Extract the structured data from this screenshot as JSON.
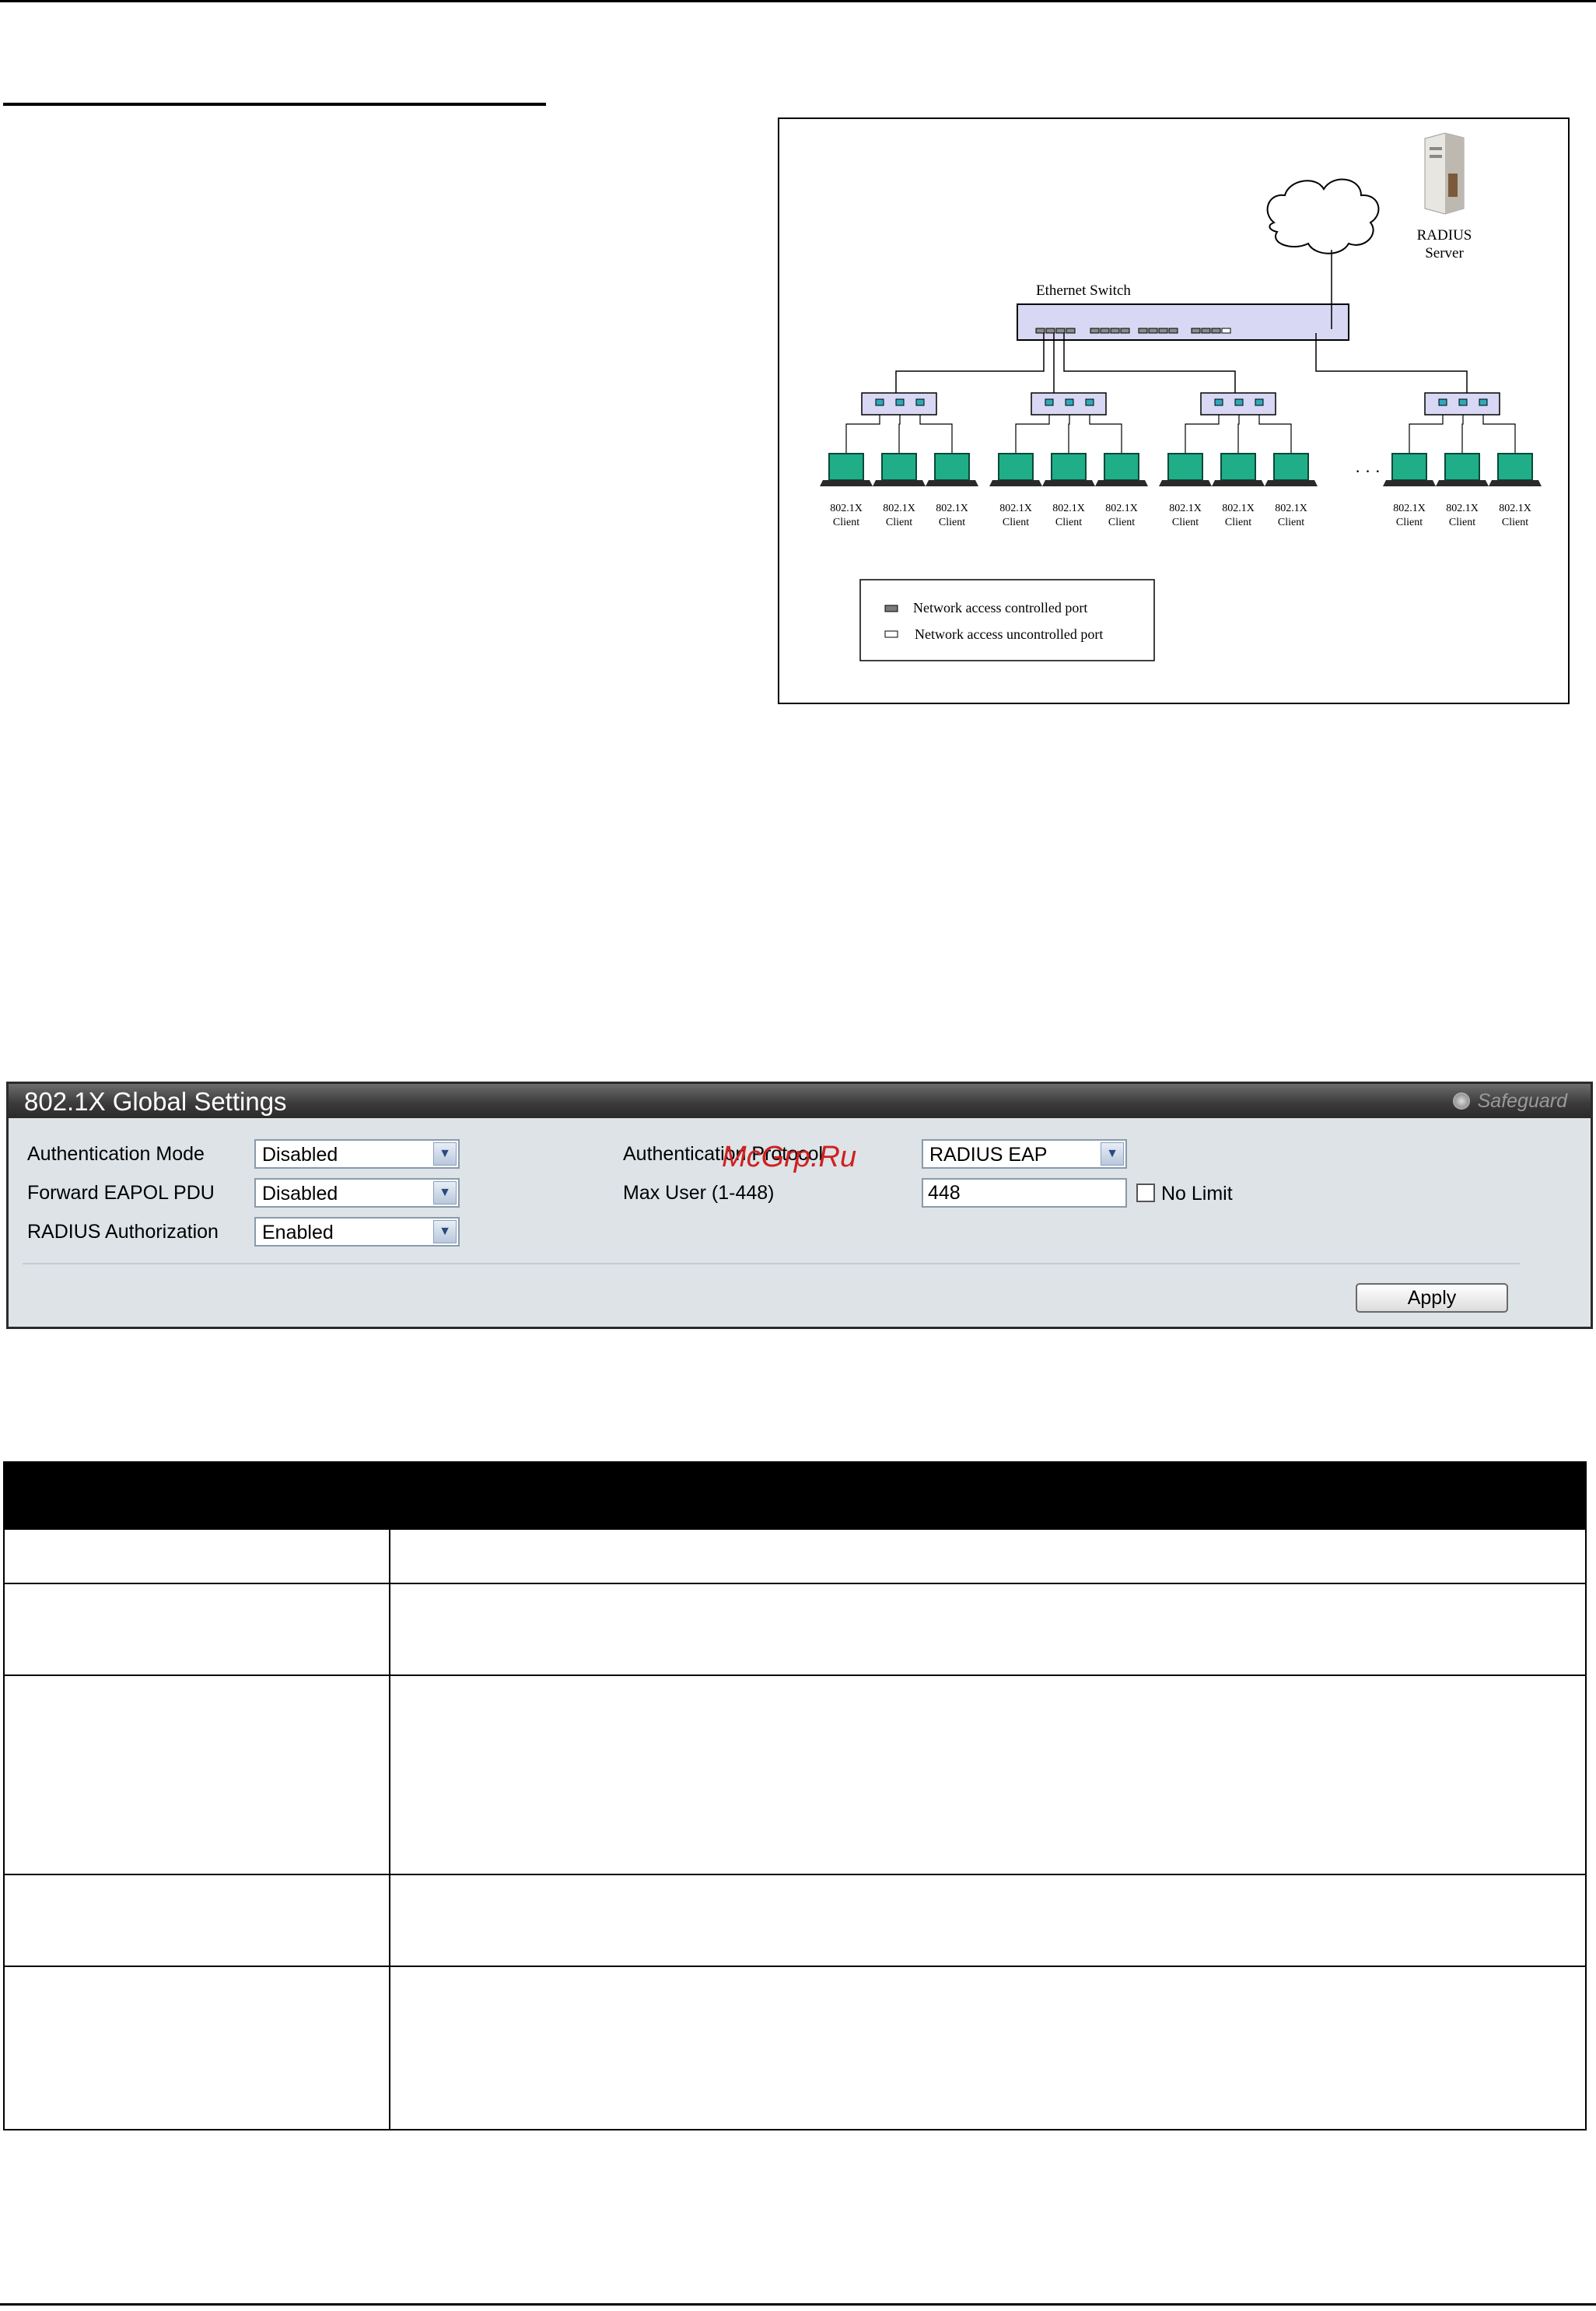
{
  "diagram": {
    "switch_label": "Ethernet Switch",
    "server_label_line1": "RADIUS",
    "server_label_line2": "Server",
    "client_label_line1": "802.1X",
    "client_label_line2": "Client",
    "ellipsis": "· · ·",
    "legend": {
      "controlled": "Network access controlled port",
      "uncontrolled": "Network access uncontrolled port"
    },
    "colors": {
      "switch_fill": "#d8d8f4",
      "client_screen": "#1fae87"
    }
  },
  "panel": {
    "title": "802.1X Global Settings",
    "safeguard_label": "Safeguard",
    "fields": {
      "authentication_mode": {
        "label": "Authentication Mode",
        "value": "Disabled"
      },
      "forward_eapol_pdu": {
        "label": "Forward EAPOL PDU",
        "value": "Disabled"
      },
      "radius_authorization": {
        "label": "RADIUS Authorization",
        "value": "Enabled"
      },
      "authentication_protocol": {
        "label": "Authentication Protocol",
        "value": "RADIUS EAP"
      },
      "max_user": {
        "label": "Max User (1-448)",
        "value": "448"
      },
      "no_limit": {
        "label": "No Limit",
        "checked": false
      }
    },
    "apply_label": "Apply",
    "watermark": "McGrp.Ru"
  }
}
